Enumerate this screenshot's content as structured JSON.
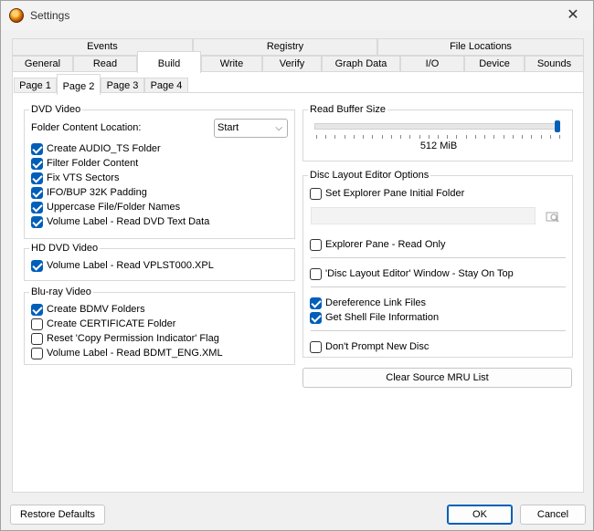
{
  "window": {
    "title": "Settings"
  },
  "tabs_row1": [
    "Events",
    "Registry",
    "File Locations"
  ],
  "tabs_row2": [
    "General",
    "Read",
    "Build",
    "Write",
    "Verify",
    "Graph Data",
    "I/O",
    "Device",
    "Sounds"
  ],
  "subtabs": [
    "Page 1",
    "Page 2",
    "Page 3",
    "Page 4"
  ],
  "dvd_video": {
    "title": "DVD Video",
    "folder_location_label": "Folder Content Location:",
    "folder_location_value": "Start",
    "options": [
      {
        "label": "Create AUDIO_TS Folder",
        "checked": true
      },
      {
        "label": "Filter Folder Content",
        "checked": true
      },
      {
        "label": "Fix VTS Sectors",
        "checked": true
      },
      {
        "label": "IFO/BUP 32K Padding",
        "checked": true
      },
      {
        "label": "Uppercase File/Folder Names",
        "checked": true
      },
      {
        "label": "Volume Label - Read DVD Text Data",
        "checked": true
      }
    ]
  },
  "hd_dvd_video": {
    "title": "HD DVD Video",
    "options": [
      {
        "label": "Volume Label - Read VPLST000.XPL",
        "checked": true
      }
    ]
  },
  "bluray_video": {
    "title": "Blu-ray Video",
    "options": [
      {
        "label": "Create BDMV Folders",
        "checked": true
      },
      {
        "label": "Create CERTIFICATE Folder",
        "checked": false
      },
      {
        "label": "Reset 'Copy Permission Indicator' Flag",
        "checked": false
      },
      {
        "label": "Volume Label - Read BDMT_ENG.XML",
        "checked": false
      }
    ]
  },
  "read_buffer": {
    "title": "Read Buffer Size",
    "value_label": "512 MiB",
    "level": 1.0
  },
  "disc_layout": {
    "title": "Disc Layout Editor Options",
    "set_explorer": {
      "label": "Set Explorer Pane Initial Folder",
      "checked": false
    },
    "explorer_readonly": {
      "label": "Explorer Pane - Read Only",
      "checked": false
    },
    "stay_on_top": {
      "label": "'Disc Layout Editor' Window - Stay On Top",
      "checked": false
    },
    "deref_links": {
      "label": "Dereference Link Files",
      "checked": true
    },
    "shell_info": {
      "label": "Get Shell File Information",
      "checked": true
    },
    "no_prompt": {
      "label": "Don't Prompt New Disc",
      "checked": false
    }
  },
  "buttons": {
    "clear_mru": "Clear Source MRU List",
    "restore": "Restore Defaults",
    "ok": "OK",
    "cancel": "Cancel"
  }
}
